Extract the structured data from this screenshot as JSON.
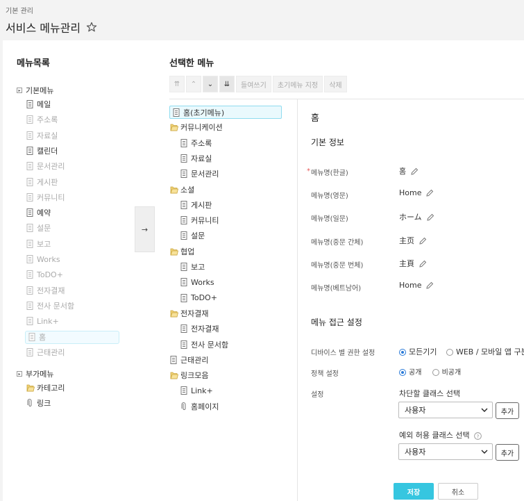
{
  "breadcrumb": "기본 관리",
  "page_title": "서비스 메뉴관리",
  "left": {
    "title": "메뉴목록",
    "basic_group": "기본메뉴",
    "basic_items": [
      {
        "label": "메일",
        "state": "normal"
      },
      {
        "label": "주소록",
        "state": "dim"
      },
      {
        "label": "자료실",
        "state": "dim"
      },
      {
        "label": "캘린더",
        "state": "normal"
      },
      {
        "label": "문서관리",
        "state": "dim"
      },
      {
        "label": "게시판",
        "state": "dim"
      },
      {
        "label": "커뮤니티",
        "state": "dim"
      },
      {
        "label": "예약",
        "state": "normal"
      },
      {
        "label": "설문",
        "state": "dim"
      },
      {
        "label": "보고",
        "state": "dim"
      },
      {
        "label": "Works",
        "state": "dim"
      },
      {
        "label": "ToDO+",
        "state": "dim"
      },
      {
        "label": "전자결재",
        "state": "dim"
      },
      {
        "label": "전사 문서함",
        "state": "dim"
      },
      {
        "label": "Link+",
        "state": "dim"
      },
      {
        "label": "홈",
        "state": "highlight"
      },
      {
        "label": "근태관리",
        "state": "dim"
      }
    ],
    "extra_group": "부가메뉴",
    "extra_items": [
      {
        "label": "카테고리",
        "icon": "folder-icon"
      },
      {
        "label": "링크",
        "icon": "link-icon"
      }
    ]
  },
  "move_button": "→",
  "right": {
    "title": "선택한 메뉴",
    "toolbar": {
      "top": "⇈",
      "up": "⌃",
      "down": "⌄",
      "bottom": "⇊",
      "indent": "들여쓰기",
      "set_initial": "초기메뉴 지정",
      "delete": "삭제"
    },
    "tree": [
      {
        "label": "홈(초기메뉴)",
        "level": 0,
        "icon": "page-icon",
        "selected": true
      },
      {
        "label": "커뮤니케이션",
        "level": 0,
        "icon": "folder-icon"
      },
      {
        "label": "주소록",
        "level": 1,
        "icon": "page-icon"
      },
      {
        "label": "자료실",
        "level": 1,
        "icon": "page-icon"
      },
      {
        "label": "문서관리",
        "level": 1,
        "icon": "page-icon"
      },
      {
        "label": "소셜",
        "level": 0,
        "icon": "folder-icon"
      },
      {
        "label": "게시판",
        "level": 1,
        "icon": "page-icon"
      },
      {
        "label": "커뮤니티",
        "level": 1,
        "icon": "page-icon"
      },
      {
        "label": "설문",
        "level": 1,
        "icon": "page-icon"
      },
      {
        "label": "협업",
        "level": 0,
        "icon": "folder-icon"
      },
      {
        "label": "보고",
        "level": 1,
        "icon": "page-icon"
      },
      {
        "label": "Works",
        "level": 1,
        "icon": "page-icon"
      },
      {
        "label": "ToDO+",
        "level": 1,
        "icon": "page-icon"
      },
      {
        "label": "전자결재",
        "level": 0,
        "icon": "folder-icon"
      },
      {
        "label": "전자결재",
        "level": 1,
        "icon": "page-icon"
      },
      {
        "label": "전사 문서함",
        "level": 1,
        "icon": "page-icon"
      },
      {
        "label": "근태관리",
        "level": 0,
        "icon": "page-icon"
      },
      {
        "label": "링크모음",
        "level": 0,
        "icon": "folder-icon"
      },
      {
        "label": "Link+",
        "level": 1,
        "icon": "page-icon"
      },
      {
        "label": "홈페이지",
        "level": 1,
        "icon": "link-icon"
      }
    ]
  },
  "detail": {
    "title": "홈",
    "basic_info_title": "기본 정보",
    "required_mark": "*",
    "names": [
      {
        "label": "메뉴명(한글)",
        "value": "홈"
      },
      {
        "label": "메뉴명(영문)",
        "value": "Home"
      },
      {
        "label": "메뉴명(일문)",
        "value": "ホーム"
      },
      {
        "label": "메뉴명(중문 간체)",
        "value": "主页"
      },
      {
        "label": "메뉴명(중문 번체)",
        "value": "主頁"
      },
      {
        "label": "메뉴명(베트남어)",
        "value": "Home"
      }
    ],
    "access_title": "메뉴 접근 설정",
    "device_label": "디바이스 별 권한 설정",
    "device_all": "모든기기",
    "device_split": "WEB / 모바일 앱 구분",
    "policy_label": "정책 설정",
    "policy_public": "공개",
    "policy_private": "비공개",
    "setting_label": "설정",
    "block_class_label": "차단할 클래스 선택",
    "block_class_value": "사용자",
    "allow_class_label": "예외 허용 클래스 선택",
    "allow_class_value": "사용자",
    "add_label": "추가",
    "save_label": "저장",
    "cancel_label": "취소"
  }
}
